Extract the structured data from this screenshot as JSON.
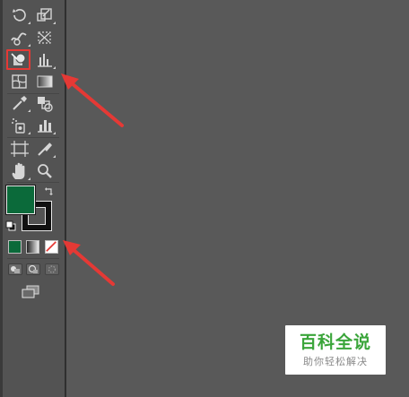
{
  "toolbar": {
    "rows": [
      {
        "left": "rotate-tool-icon",
        "right": "scale-tool-icon"
      },
      {
        "left": "warp-tool-icon",
        "right": "free-transform-tool-icon"
      },
      {
        "left": "shape-builder-tool-icon",
        "right": "graph-tool-icon"
      },
      {
        "left": "mesh-tool-icon",
        "right": "gradient-tool-icon"
      },
      {
        "left": "eyedropper-tool-icon",
        "right": "blend-tool-icon"
      },
      {
        "left": "symbol-sprayer-tool-icon",
        "right": "column-graph-tool-icon"
      },
      {
        "left": "artboard-tool-icon",
        "right": "slice-tool-icon"
      },
      {
        "left": "hand-tool-icon",
        "right": "zoom-tool-icon"
      }
    ],
    "highlighted_tool": "shape-builder-tool-icon",
    "fill_color": "#0b6a3a",
    "stroke_color": "#111111",
    "color_modes": [
      "color",
      "gradient",
      "none"
    ],
    "draw_modes": [
      "draw-normal",
      "draw-behind",
      "draw-inside"
    ],
    "screen_mode": "change-screen-mode"
  },
  "colors": {
    "canvas": "#595959",
    "panel": "#535353",
    "highlight": "#e53935",
    "arrow": "#e53935"
  },
  "watermark": {
    "title": "百科全说",
    "subtitle": "助你轻松解决"
  }
}
